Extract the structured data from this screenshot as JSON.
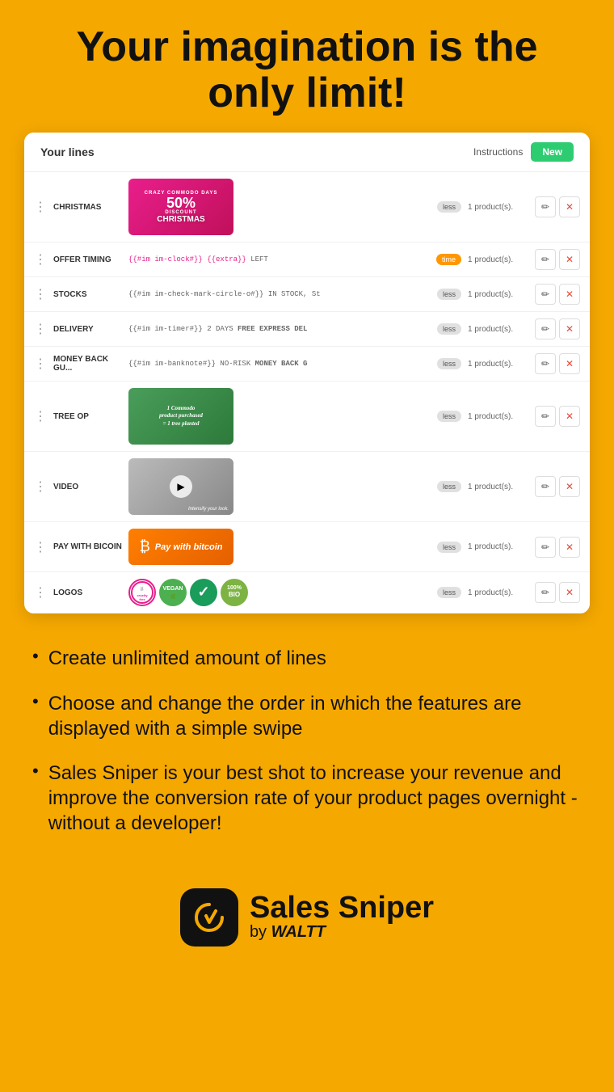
{
  "hero": {
    "title": "Your imagination is the only limit!"
  },
  "app": {
    "header": {
      "title": "Your lines",
      "instructions_label": "Instructions",
      "new_button_label": "New"
    },
    "lines": [
      {
        "id": "christmas",
        "name": "CHRISTMAS",
        "preview_type": "image",
        "preview_text": "",
        "badge": "less",
        "product_count": "1 product(s)."
      },
      {
        "id": "offer-timing",
        "name": "OFFER TIMING",
        "preview_type": "text",
        "preview_text": "{{#im im-clock#}} {{extra}} LEFT",
        "badge": "time",
        "product_count": "1 product(s)."
      },
      {
        "id": "stocks",
        "name": "STOCKS",
        "preview_type": "text",
        "preview_text": "{{#im im-check-mark-circle-o#}} IN STOCK, St",
        "badge": "less",
        "product_count": "1 product(s)."
      },
      {
        "id": "delivery",
        "name": "DELIVERY",
        "preview_type": "text",
        "preview_text": "{{#im im-timer#}} 2 DAYS FREE EXPRESS DEL",
        "badge": "less",
        "product_count": "1 product(s)."
      },
      {
        "id": "money-back",
        "name": "MONEY BACK GU...",
        "preview_type": "text",
        "preview_text": "{{#im im-banknote#}} NO-RISK MONEY BACK G",
        "badge": "less",
        "product_count": "1 product(s)."
      },
      {
        "id": "tree-op",
        "name": "TREE OP",
        "preview_type": "image-tree",
        "preview_text": "1 Commodo product purchased = 1 tree planted",
        "badge": "less",
        "product_count": "1 product(s)."
      },
      {
        "id": "video",
        "name": "VIDEO",
        "preview_type": "image-video",
        "preview_text": "Intensify your look.",
        "badge": "less",
        "product_count": "1 product(s)."
      },
      {
        "id": "pay-with-bitcoin",
        "name": "PAY WITH BICOIN",
        "preview_type": "image-bitcoin",
        "preview_text": "Pay with bitcoin",
        "badge": "less",
        "product_count": "1 product(s)."
      },
      {
        "id": "logos",
        "name": "LOGOS",
        "preview_type": "image-logos",
        "preview_text": "",
        "badge": "less",
        "product_count": "1 product(s)."
      }
    ]
  },
  "bullets": [
    {
      "text": "Create unlimited amount of lines"
    },
    {
      "text": "Choose and change the order in which the features are displayed with a simple swipe"
    },
    {
      "text": "Sales Sniper is your best shot to increase your revenue and improve the conversion rate of your product pages overnight - without a developer!"
    }
  ],
  "brand": {
    "name": "Sales Sniper",
    "by_label": "by ",
    "company": "WALTT"
  }
}
